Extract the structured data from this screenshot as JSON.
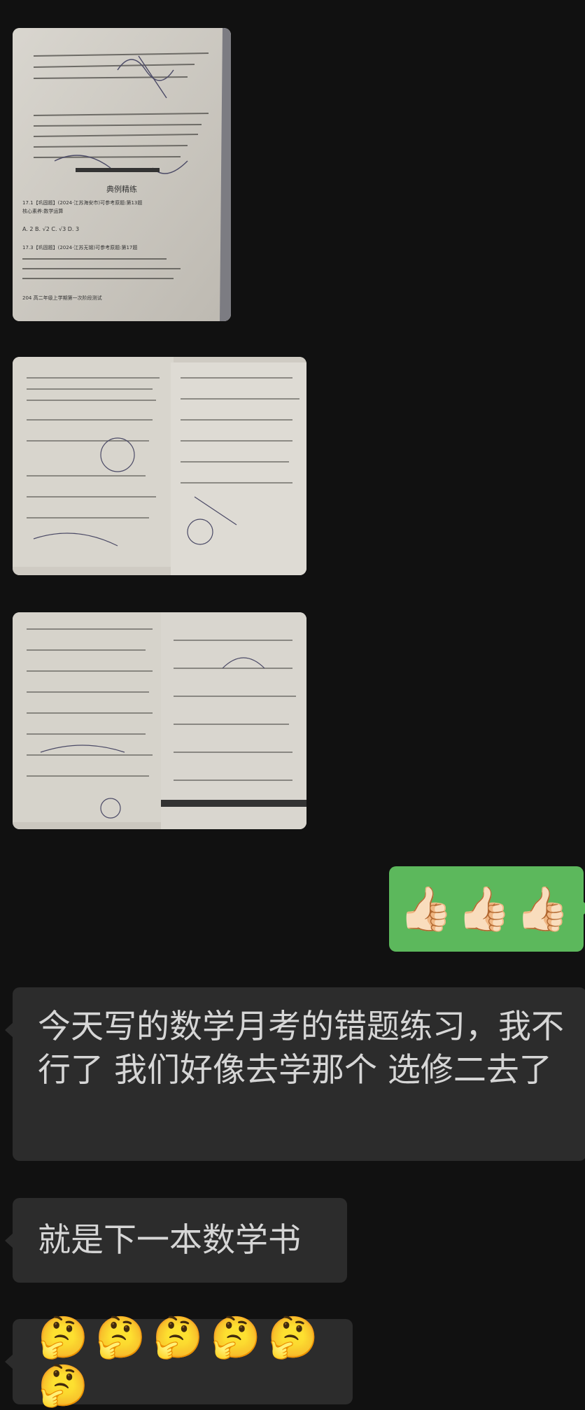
{
  "images": [
    {
      "description_name": "exam-paper-photo-1"
    },
    {
      "description_name": "exam-paper-photo-2"
    },
    {
      "description_name": "exam-paper-photo-3"
    }
  ],
  "outgoing": {
    "emoji": "👍🏻👍🏻👍🏻"
  },
  "incoming": [
    {
      "text": "今天写的数学月考的错题练习，我不行了 我们好像去学那个 选修二去了"
    },
    {
      "text": "就是下一本数学书"
    },
    {
      "text": "🤔🤔🤔🤔🤔🤔"
    }
  ],
  "colors": {
    "background": "#111111",
    "incoming_bubble": "#2c2c2c",
    "outgoing_bubble": "#5cb85c",
    "text": "#d6d6d6"
  },
  "paper_text": {
    "p1_heading": "典例精练",
    "p1_q1": "17.1【巩固题】(2024·江苏海安市)可参考原题:第13题",
    "p1_q2": "核心素养:数学运算",
    "p1_choices": "A. 2      B. √2      C. √3      D. 3",
    "p1_q3": "17.3【巩固题】(2024·江苏无锡)可参考原题:第17题",
    "p1_footer": "204  高二年级上学期第一次阶段测试"
  }
}
